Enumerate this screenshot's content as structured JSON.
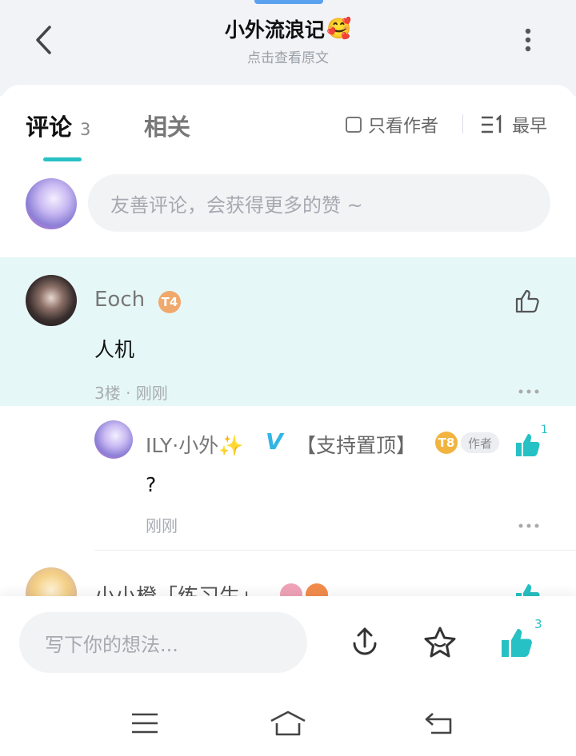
{
  "header": {
    "title": "小外流浪记",
    "title_emoji": "🥰",
    "subtitle": "点击查看原文"
  },
  "tabs": {
    "comments_label": "评论",
    "comments_count": "3",
    "related_label": "相关",
    "filter_author_label": "只看作者",
    "sort_label": "最早"
  },
  "composer": {
    "placeholder": "友善评论，会获得更多的赞 ~"
  },
  "comments": [
    {
      "name": "Eoch",
      "level": "T4",
      "text": "人机",
      "meta": "3楼 · 刚刚"
    }
  ],
  "reply": {
    "name": "ILY·小外",
    "sparkle": "✨",
    "v_badge": "V",
    "suffix": "【支持置顶】",
    "level": "T8",
    "author_tag": "作者",
    "like_count": "1",
    "text": "?",
    "meta": "刚刚"
  },
  "next_comment": {
    "name": "小小橙「练习生」"
  },
  "bottom_bar": {
    "write_placeholder": "写下你的想法...",
    "like_count": "3"
  },
  "colors": {
    "accent": "#26c1c4",
    "highlight_bg": "#e6f7f7",
    "topbar_bg": "#f2f3f6"
  }
}
